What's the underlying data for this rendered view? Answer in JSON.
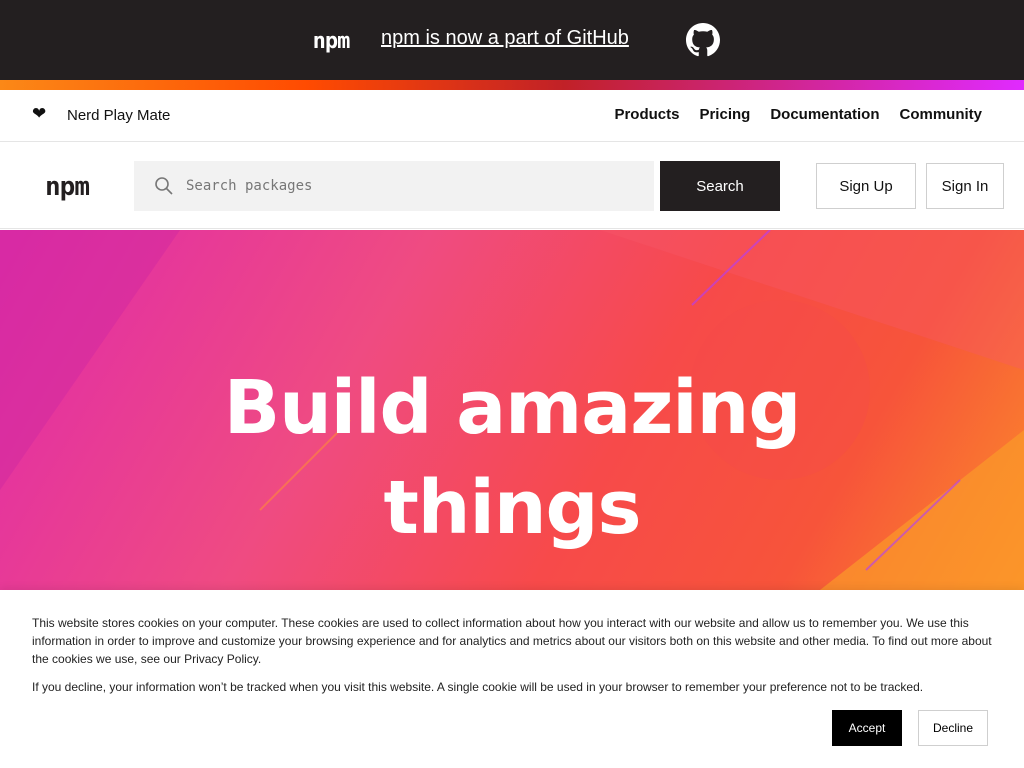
{
  "banner": {
    "logo_text": "npm",
    "announcement_link": "npm is now a part of GitHub",
    "github_icon": "github-icon"
  },
  "subnav": {
    "heart_icon": "heart-icon",
    "tagline": "Nerd Play Mate",
    "links": [
      "Products",
      "Pricing",
      "Documentation",
      "Community"
    ]
  },
  "header": {
    "logo_text": "npm",
    "search_placeholder": "Search packages",
    "search_button": "Search",
    "signup_label": "Sign Up",
    "signin_label": "Sign In"
  },
  "hero": {
    "title_line1": "Build amazing",
    "title_line2": "things"
  },
  "cookie": {
    "text1": "This website stores cookies on your computer. These cookies are used to collect information about how you interact with our website and allow us to remember you. We use this information in order to improve and customize your browsing experience and for analytics and metrics about our visitors both on this website and other media. To find out more about the cookies we use, see our Privacy Policy.",
    "text2": "If you decline, your information won’t be tracked when you visit this website. A single cookie will be used in your browser to remember your preference not to be tracked.",
    "accept_label": "Accept",
    "decline_label": "Decline"
  },
  "colors": {
    "banner_bg": "#231f20",
    "hero_pink": "#e02aaa",
    "hero_orange": "#fb8c2a",
    "button_dark": "#231f20"
  }
}
